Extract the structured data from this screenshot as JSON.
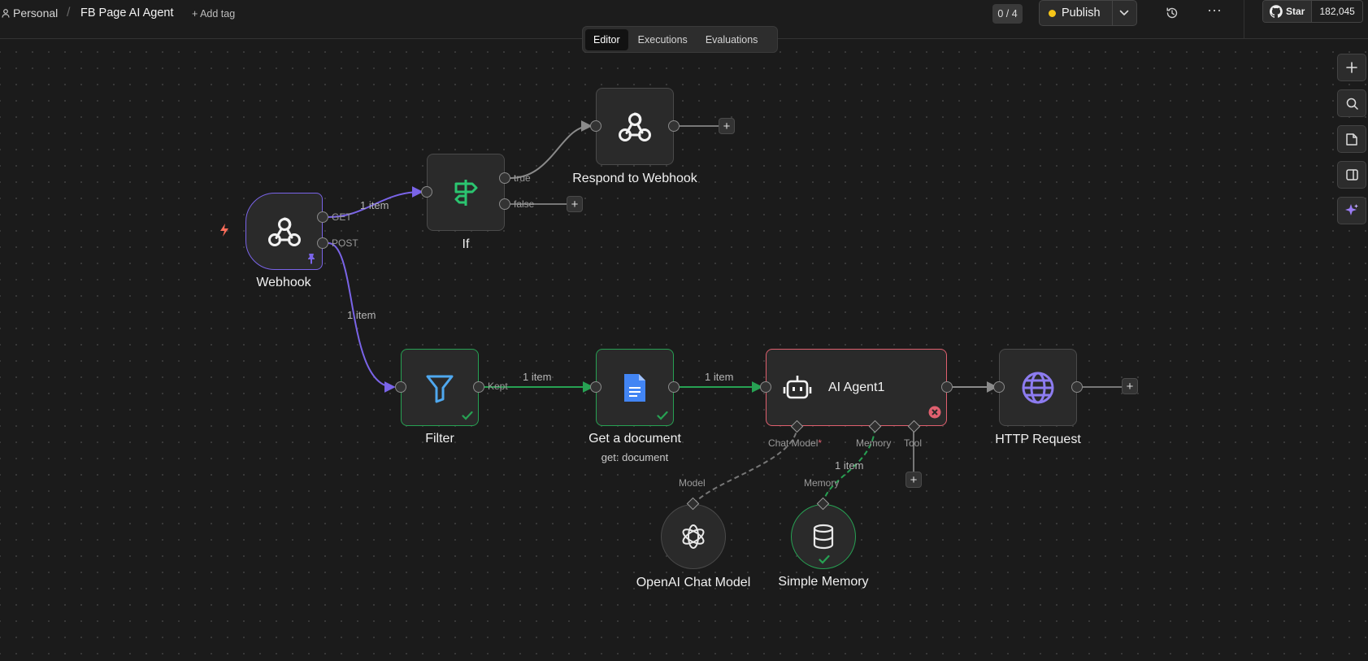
{
  "header": {
    "workspace": "Personal",
    "separator": "/",
    "workflow_title": "FB Page AI Agent",
    "add_tag": "+ Add tag",
    "counter": "0 / 4",
    "publish_label": "Publish",
    "more": "···",
    "github_star_label": "Star",
    "github_star_count": "182,045"
  },
  "tabs": [
    {
      "label": "Editor",
      "active": true
    },
    {
      "label": "Executions",
      "active": false
    },
    {
      "label": "Evaluations",
      "active": false
    }
  ],
  "nodes": {
    "webhook": {
      "label": "Webhook",
      "ports": [
        "GET",
        "POST"
      ]
    },
    "if": {
      "label": "If",
      "ports": [
        "true",
        "false"
      ]
    },
    "respond": {
      "label": "Respond to Webhook"
    },
    "filter": {
      "label": "Filter",
      "port": "Kept"
    },
    "get_document": {
      "label": "Get a document",
      "sublabel": "get: document"
    },
    "ai_agent": {
      "label": "AI Agent1",
      "ports": [
        "Chat Model",
        "Memory",
        "Tool"
      ],
      "required_mark": "*"
    },
    "http": {
      "label": "HTTP Request"
    },
    "openai": {
      "label": "OpenAI Chat Model",
      "port": "Model"
    },
    "memory": {
      "label": "Simple Memory",
      "port": "Memory"
    }
  },
  "edges": {
    "webhook_if": "1 item",
    "webhook_filter": "1 item",
    "filter_doc": "1 item",
    "doc_agent": "1 item",
    "memory_agent": "1 item"
  },
  "plus": "+",
  "colors": {
    "accent_purple": "#7a64e8",
    "success_green": "#27a153",
    "error_red": "#e0606f",
    "publish_dot": "#f5c518",
    "google_doc_blue": "#4285f4",
    "http_globe": "#8d7cf0"
  }
}
